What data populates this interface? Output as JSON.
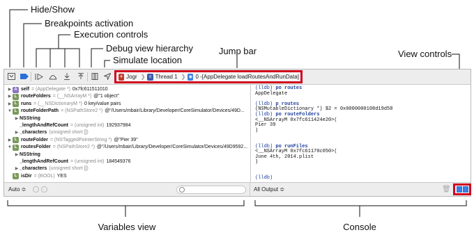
{
  "callouts": {
    "hide_show": "Hide/Show",
    "breakpoints": "Breakpoints activation",
    "execution": "Execution controls",
    "debug_view": "Debug view hierarchy",
    "simulate": "Simulate location",
    "jump_bar": "Jump bar",
    "view_controls": "View controls",
    "variables_view": "Variables view",
    "console": "Console"
  },
  "jump_bar": {
    "app": "Jogr",
    "thread": "Thread 1",
    "frame": "0 -[AppDelegate loadRoutesAndRunData]"
  },
  "variables": [
    {
      "disc": "▶",
      "icon": "A",
      "name": "self",
      "type": "= (AppDelegate *)",
      "value": "0x7fc611511010"
    },
    {
      "disc": "▶",
      "icon": "L",
      "name": "routeFolders",
      "type": "= (__NSArrayM *)",
      "value": "@\"1 object\""
    },
    {
      "disc": "▶",
      "icon": "L",
      "name": "runs",
      "type": "= (__NSDictionaryM *)",
      "value": "0 key/value pairs"
    },
    {
      "disc": "▼",
      "icon": "L",
      "name": "routeFolderPath",
      "type": "= (NSPathStore2 *)",
      "value": "@\"/Users/mbair/Library/Developer/CoreSimulator/Devices/49D..."
    },
    {
      "disc": "▶",
      "icon": "",
      "name": "NSString",
      "type": "",
      "value": ""
    },
    {
      "disc": "",
      "icon": "",
      "name": "_lengthAndRefCount",
      "type": "= (unsigned int)",
      "value": "192937984"
    },
    {
      "disc": "▶",
      "icon": "",
      "name": "_characters",
      "type": "(unsigned short [])",
      "value": ""
    },
    {
      "disc": "▶",
      "icon": "L",
      "name": "routeFolder",
      "type": "= (NSTaggedPointerString *)",
      "value": "@\"Pier 39\""
    },
    {
      "disc": "▼",
      "icon": "L",
      "name": "routesFolder",
      "type": "= (NSPathStore2 *)",
      "value": "@\"/Users/mbair/Library/Developer/CoreSimulator/Devices/49D9592..."
    },
    {
      "disc": "▶",
      "icon": "",
      "name": "NSString",
      "type": "",
      "value": ""
    },
    {
      "disc": "",
      "icon": "",
      "name": "_lengthAndRefCount",
      "type": "= (unsigned int)",
      "value": "184549376"
    },
    {
      "disc": "▶",
      "icon": "",
      "name": "_characters",
      "type": "(unsigned short [])",
      "value": ""
    },
    {
      "disc": "",
      "icon": "L",
      "name": "isDir",
      "type": "= (BOOL)",
      "value": "YES"
    }
  ],
  "console_lines": [
    {
      "kind": "cmd",
      "prompt": "(lldb) ",
      "text": "po routes"
    },
    {
      "kind": "out",
      "prompt": "",
      "text": "AppDelegate"
    },
    {
      "kind": "blank",
      "prompt": "",
      "text": ""
    },
    {
      "kind": "cmd",
      "prompt": "(lldb) ",
      "text": "p routes"
    },
    {
      "kind": "out",
      "prompt": "",
      "text": "(NSMutableDictionary *) $2 = 0x0000000108d19d58"
    },
    {
      "kind": "cmd",
      "prompt": "(lldb) ",
      "text": "po routeFolders"
    },
    {
      "kind": "out",
      "prompt": "",
      "text": "<__NSArrayM 0x7fc611424e20>("
    },
    {
      "kind": "out",
      "prompt": "",
      "text": "Pier 39"
    },
    {
      "kind": "out",
      "prompt": "",
      "text": ")"
    },
    {
      "kind": "blank",
      "prompt": "",
      "text": ""
    },
    {
      "kind": "blank",
      "prompt": "",
      "text": ""
    },
    {
      "kind": "cmd",
      "prompt": "(lldb) ",
      "text": "po runFiles"
    },
    {
      "kind": "out",
      "prompt": "",
      "text": "<__NSArrayM 0x7fc61170c050>("
    },
    {
      "kind": "out",
      "prompt": "",
      "text": "June 4th, 2014.plist"
    },
    {
      "kind": "out",
      "prompt": "",
      "text": ")"
    },
    {
      "kind": "blank",
      "prompt": "",
      "text": ""
    },
    {
      "kind": "blank",
      "prompt": "",
      "text": ""
    },
    {
      "kind": "cmd",
      "prompt": "(lldb)",
      "text": ""
    }
  ],
  "bottom_bar": {
    "scope_label": "Auto ≎",
    "output_label": "All Output ≎"
  },
  "colors": {
    "highlight": "#d0021b",
    "accent": "#3b7fe3"
  }
}
